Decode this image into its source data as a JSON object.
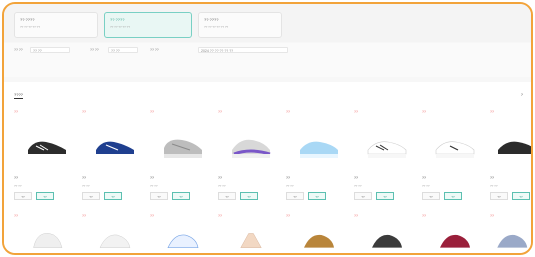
{
  "top_cards": [
    {
      "title": "?? ????",
      "sub": "?? ?? ?? ?? ??"
    },
    {
      "title": "?? ????",
      "sub": "?? ?? ?? ?? ??"
    },
    {
      "title": "?? ????",
      "sub": "?? ?? ?? ?? ?? ??"
    }
  ],
  "filters": {
    "label_1": "?? ??",
    "value_1": "?? ??",
    "label_2": "?? ??",
    "value_2": "?? ??",
    "label_3": "?? ??",
    "value_3": "2024 ?? ?? ?? ?? ??",
    "tags": [
      "?? ??",
      "?? ??",
      "?? ?? ??",
      "?? ?? ??",
      "?? ??",
      "?? ?? ??"
    ],
    "right_text": "?? ??"
  },
  "section": {
    "title": "????",
    "more": "?"
  },
  "products": [
    {
      "badge": "??",
      "name": "??",
      "meta": "?? ??",
      "btn_a": "??",
      "btn_b": "??"
    },
    {
      "badge": "??",
      "name": "??",
      "meta": "?? ??",
      "btn_a": "??",
      "btn_b": "??"
    },
    {
      "badge": "??",
      "name": "??",
      "meta": "?? ??",
      "btn_a": "??",
      "btn_b": "??"
    },
    {
      "badge": "??",
      "name": "??",
      "meta": "?? ??",
      "btn_a": "??",
      "btn_b": "??"
    },
    {
      "badge": "??",
      "name": "??",
      "meta": "?? ??",
      "btn_a": "??",
      "btn_b": "??"
    },
    {
      "badge": "??",
      "name": "??",
      "meta": "?? ??",
      "btn_a": "??",
      "btn_b": "??"
    },
    {
      "badge": "??",
      "name": "??",
      "meta": "?? ??",
      "btn_a": "??",
      "btn_b": "??"
    },
    {
      "badge": "??",
      "name": "??",
      "meta": "?? ??",
      "btn_a": "??",
      "btn_b": "??"
    }
  ],
  "products_row2": [
    {
      "badge": "??"
    },
    {
      "badge": "??"
    },
    {
      "badge": "??"
    },
    {
      "badge": "??"
    },
    {
      "badge": "??"
    },
    {
      "badge": "??"
    },
    {
      "badge": "??"
    },
    {
      "badge": "??"
    }
  ],
  "colors": {
    "border": "#f2a33a",
    "accent": "#5cc0b1",
    "badge": "#e66666"
  }
}
